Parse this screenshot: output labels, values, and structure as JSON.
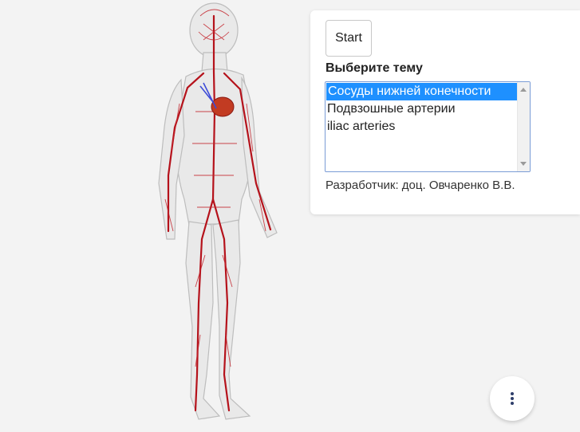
{
  "viewer": {
    "model": "human-circulatory-system-3d"
  },
  "panel": {
    "start_label": "Start",
    "topic_label": "Выберите тему",
    "topics": [
      "Сосуды нижней конечности",
      "Подвзошные артерии",
      "iliac arteries"
    ],
    "selected_topic": "Сосуды нижней конечности",
    "developer": "Разработчик: доц. Овчаренко В.В."
  },
  "fab": {
    "icon": "more-vertical-icon"
  },
  "colors": {
    "background": "#f3f3f3",
    "vessel": "#b5121b",
    "selection": "#1e90ff",
    "fab_dots": "#2f3e6a"
  }
}
